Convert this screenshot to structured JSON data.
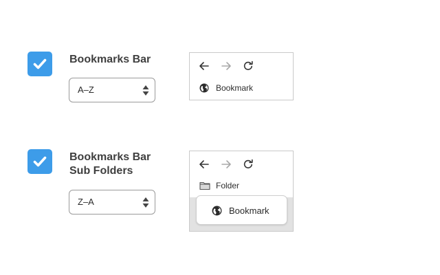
{
  "options": [
    {
      "checked": true,
      "label_lines": [
        "Bookmarks Bar"
      ],
      "sort_value": "A–Z",
      "preview": {
        "items": [
          {
            "icon": "globe-icon",
            "label": "Bookmark"
          }
        ]
      }
    },
    {
      "checked": true,
      "label_lines": [
        "Bookmarks Bar",
        "Sub Folders"
      ],
      "sort_value": "Z–A",
      "preview": {
        "items": [
          {
            "icon": "folder-icon",
            "label": "Folder"
          }
        ],
        "popup": {
          "icon": "globe-icon",
          "label": "Bookmark"
        }
      }
    }
  ],
  "colors": {
    "checkbox_accent": "#3d9ce9",
    "preview_popup_backdrop": "#e2e2e2"
  },
  "icons": {
    "nav_back": "arrow-left-icon",
    "nav_forward": "arrow-right-icon",
    "nav_reload": "reload-icon"
  }
}
